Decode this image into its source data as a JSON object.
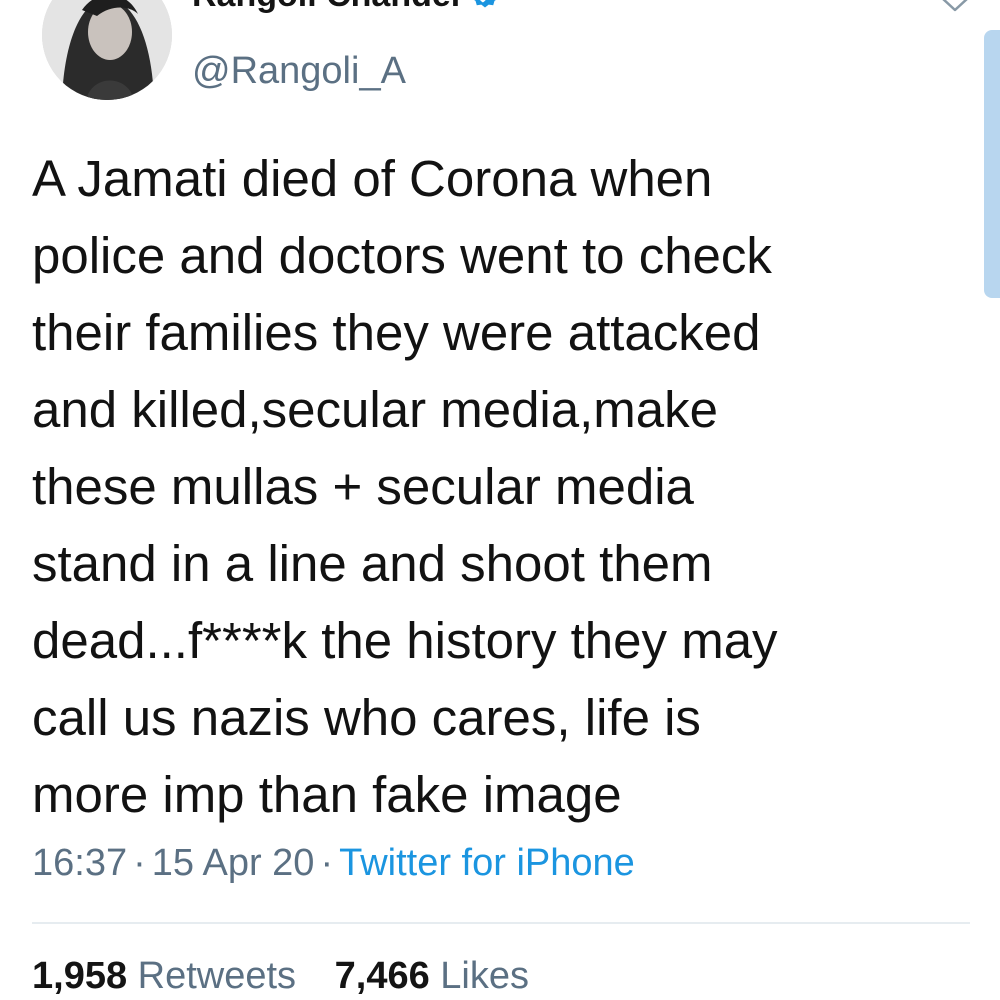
{
  "user": {
    "display_name": "Rangoli Chandel",
    "handle": "@Rangoli_A",
    "verified": true
  },
  "tweet": {
    "text": "A Jamati died of Corona when\npolice and doctors went to check\ntheir families they were attacked\nand killed,secular media,make\nthese mullas + secular media\nstand in a line and shoot them\ndead...f****k the history they may\ncall us nazis who cares, life is\nmore imp than fake image",
    "time": "16:37",
    "separator": "·",
    "date": "15 Apr 20",
    "source": "Twitter for iPhone"
  },
  "stats": {
    "retweets_count": "1,958",
    "retweets_label": "Retweets",
    "likes_count": "7,466",
    "likes_label": "Likes"
  },
  "colors": {
    "accent": "#1b95e0",
    "secondary_text": "#5b7083",
    "primary_text": "#141414"
  },
  "icons": {
    "verified": "verified-badge-icon",
    "caret": "chevron-down-icon"
  }
}
